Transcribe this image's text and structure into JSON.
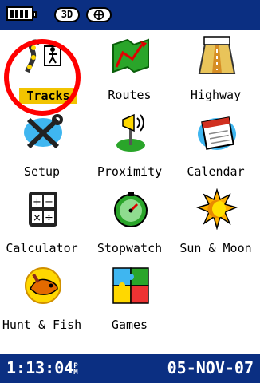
{
  "status": {
    "threed_label": "3D",
    "accent": "#0b2f82"
  },
  "menu": [
    {
      "label": "Tracks",
      "icon": "tracks-icon",
      "selected": true
    },
    {
      "label": "Routes",
      "icon": "routes-icon"
    },
    {
      "label": "Highway",
      "icon": "highway-icon"
    },
    {
      "label": "Setup",
      "icon": "setup-icon"
    },
    {
      "label": "Proximity",
      "icon": "proximity-icon"
    },
    {
      "label": "Calendar",
      "icon": "calendar-icon"
    },
    {
      "label": "Calculator",
      "icon": "calculator-icon"
    },
    {
      "label": "Stopwatch",
      "icon": "stopwatch-icon"
    },
    {
      "label": "Sun & Moon",
      "icon": "sun-moon-icon"
    },
    {
      "label": "Hunt & Fish",
      "icon": "hunt-fish-icon"
    },
    {
      "label": "Games",
      "icon": "games-icon"
    }
  ],
  "footer": {
    "time": "1:13:04",
    "ampm": "PM",
    "date": "05-NOV-07"
  }
}
